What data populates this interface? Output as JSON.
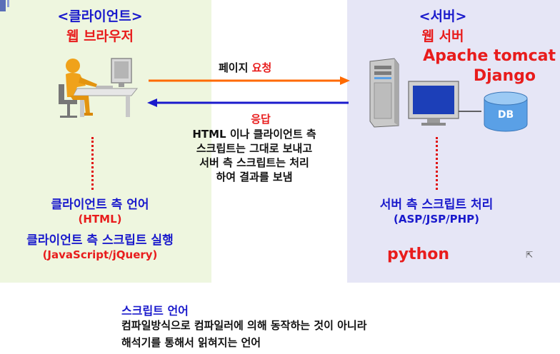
{
  "client": {
    "heading": "<클라이언트>",
    "title": "웹 브라우저",
    "lang_label": "클라이언트 측 언어",
    "lang_value": "(HTML)",
    "script_label": "클라이언트 측 스크립트 실행",
    "script_value": "(JavaScript/jQuery)"
  },
  "server": {
    "heading": "<서버>",
    "title": "웹 서버",
    "software_1": "Apache tomcat",
    "software_2": "Django",
    "db_label": "DB",
    "script_label": "서버 측 스크립트 처리",
    "script_value": "(ASP/JSP/PHP)",
    "python_label": "python"
  },
  "request": {
    "label_prefix": "페이지",
    "label_highlight": "요청"
  },
  "response": {
    "label": "응답",
    "lines": [
      "HTML 이나 클라이언트 측",
      "스크립트는 그대로 보내고",
      "서버 측 스크립트는 처리",
      "하여 결과를 보냄"
    ]
  },
  "footer": {
    "title": "스크립트 언어",
    "lines": [
      "컴파일방식으로 컴파일러에 의해 동작하는 것이 아니라",
      "해석기를 통해서 읽혀지는 언어"
    ]
  },
  "colors": {
    "request_arrow": "#ff6a00",
    "response_arrow": "#1a1acc",
    "client_panel": "#eef6df",
    "server_panel": "#e6e6f6",
    "heading_blue": "#1a1acc",
    "heading_red": "#e81c1c"
  },
  "icons": {
    "client": "person-at-computer-icon",
    "server": "server-tower-icon",
    "monitor": "monitor-icon",
    "database": "database-icon",
    "cursor": "mouse-pointer-icon"
  }
}
